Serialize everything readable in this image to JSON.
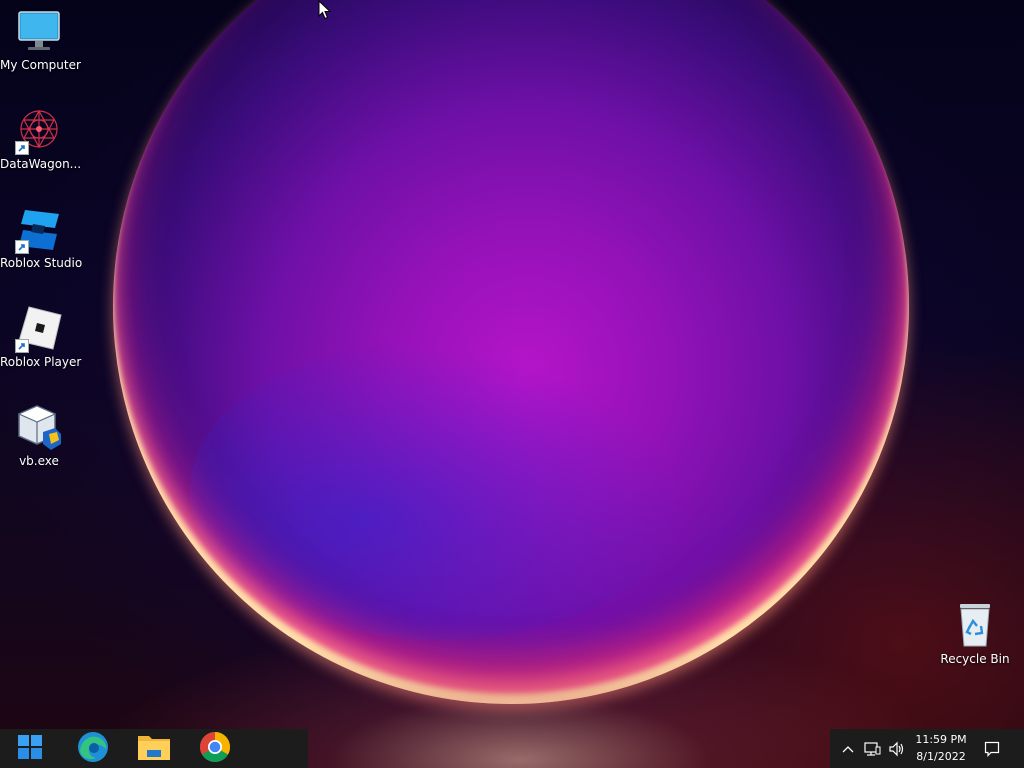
{
  "desktop": {
    "icons": [
      {
        "label": "My Computer",
        "icon": "monitor-icon",
        "shortcut": false
      },
      {
        "label": "DataWagon...",
        "icon": "datawagon-icon",
        "shortcut": true
      },
      {
        "label": "Roblox Studio",
        "icon": "roblox-studio-icon",
        "shortcut": true
      },
      {
        "label": "Roblox Player",
        "icon": "roblox-player-icon",
        "shortcut": true
      },
      {
        "label": "vb.exe",
        "icon": "virtualbox-icon",
        "shortcut": false
      }
    ],
    "recycle_bin": {
      "label": "Recycle Bin",
      "icon": "recycle-bin-icon"
    }
  },
  "taskbar": {
    "pinned": [
      {
        "name": "Start",
        "icon": "windows-start-icon"
      },
      {
        "name": "Microsoft Edge",
        "icon": "edge-icon"
      },
      {
        "name": "File Explorer",
        "icon": "file-explorer-icon"
      },
      {
        "name": "Google Chrome",
        "icon": "chrome-icon"
      }
    ],
    "tray": {
      "icons": [
        "chevron-up-icon",
        "network-icon",
        "volume-icon",
        "notification-icon"
      ],
      "time": "11:59 PM",
      "date": "8/1/2022"
    }
  },
  "colors": {
    "taskbar": "#1c1c1c",
    "accent_blue": "#0078d4",
    "sphere_magenta": "#b414c8"
  }
}
